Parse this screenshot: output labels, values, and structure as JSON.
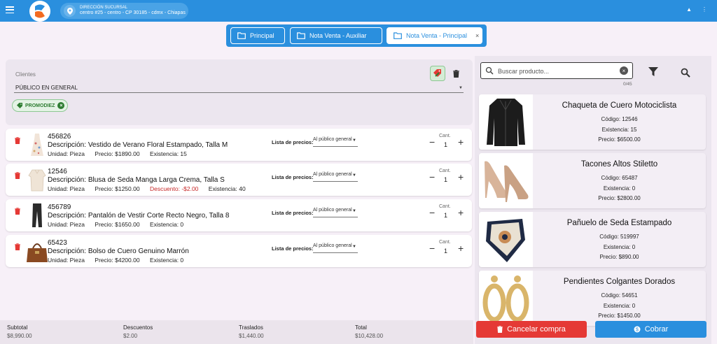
{
  "branch": {
    "label": "DIRECCIÓN SUCURSAL",
    "address": "centro #25 - centro - CP 30185 - cdmx - Chiapas"
  },
  "tabs": [
    {
      "label": "Principal"
    },
    {
      "label": "Nota Venta - Auxiliar"
    },
    {
      "label": "Nota Venta - Principal",
      "close": "×"
    }
  ],
  "client": {
    "label": "Clientes",
    "value": "PÚBLICO EN GENERAL",
    "chip": "PROMODIEZ"
  },
  "price_list_label": "Lista de precios:",
  "qty_label": "Cant.",
  "items": [
    {
      "code": "456826",
      "desc_label": "Descripción:",
      "desc": "Vestido de Verano Floral Estampado, Talla M",
      "unit": "Unidad: Pieza",
      "price": "Precio: $1890.00",
      "discount": "",
      "stock": "Existencia: 15",
      "price_list": "Al público general",
      "qty": "1"
    },
    {
      "code": "12546",
      "desc_label": "Descripción:",
      "desc": "Blusa de Seda Manga Larga Crema, Talla S",
      "unit": "Unidad: Pieza",
      "price": "Precio: $1250.00",
      "discount": "Descuento: -$2.00",
      "stock": "Existencia: 40",
      "price_list": "Al público general",
      "qty": "1"
    },
    {
      "code": "456789",
      "desc_label": "Descripción:",
      "desc": "Pantalón de Vestir Corte Recto Negro, Talla 8",
      "unit": "Unidad: Pieza",
      "price": "Precio: $1650.00",
      "discount": "",
      "stock": "Existencia: 0",
      "price_list": "Al público general",
      "qty": "1"
    },
    {
      "code": "65423",
      "desc_label": "Descripción:",
      "desc": "Bolso de Cuero Genuino Marrón",
      "unit": "Unidad: Pieza",
      "price": "Precio: $4200.00",
      "discount": "",
      "stock": "Existencia: 0",
      "price_list": "Al público general",
      "qty": "1"
    }
  ],
  "totals": {
    "subtotal_label": "Subtotal",
    "subtotal": "$8,990.00",
    "discounts_label": "Descuentos",
    "discounts": "$2.00",
    "transfers_label": "Traslados",
    "transfers": "$1,440.00",
    "total_label": "Total",
    "total": "$10,428.00"
  },
  "search": {
    "placeholder": "Buscar producto...",
    "count": "0/45"
  },
  "products": [
    {
      "name": "Chaqueta de Cuero Motociclista",
      "code": "Código: 12546",
      "stock": "Existencia: 15",
      "price": "Precio: $6500.00"
    },
    {
      "name": "Tacones Altos Stiletto",
      "code": "Código: 65487",
      "stock": "Existencia: 0",
      "price": "Precio: $2800.00"
    },
    {
      "name": "Pañuelo de Seda Estampado",
      "code": "Código: 519997",
      "stock": "Existencia: 0",
      "price": "Precio: $890.00"
    },
    {
      "name": "Pendientes Colgantes Dorados",
      "code": "Código: 54651",
      "stock": "Existencia: 0",
      "price": "Precio: $1450.00"
    }
  ],
  "actions": {
    "cancel": "Cancelar compra",
    "pay": "Cobrar"
  },
  "colors": {
    "primary": "#2a8fde",
    "danger": "#e53935",
    "success": "#2e7d32"
  }
}
